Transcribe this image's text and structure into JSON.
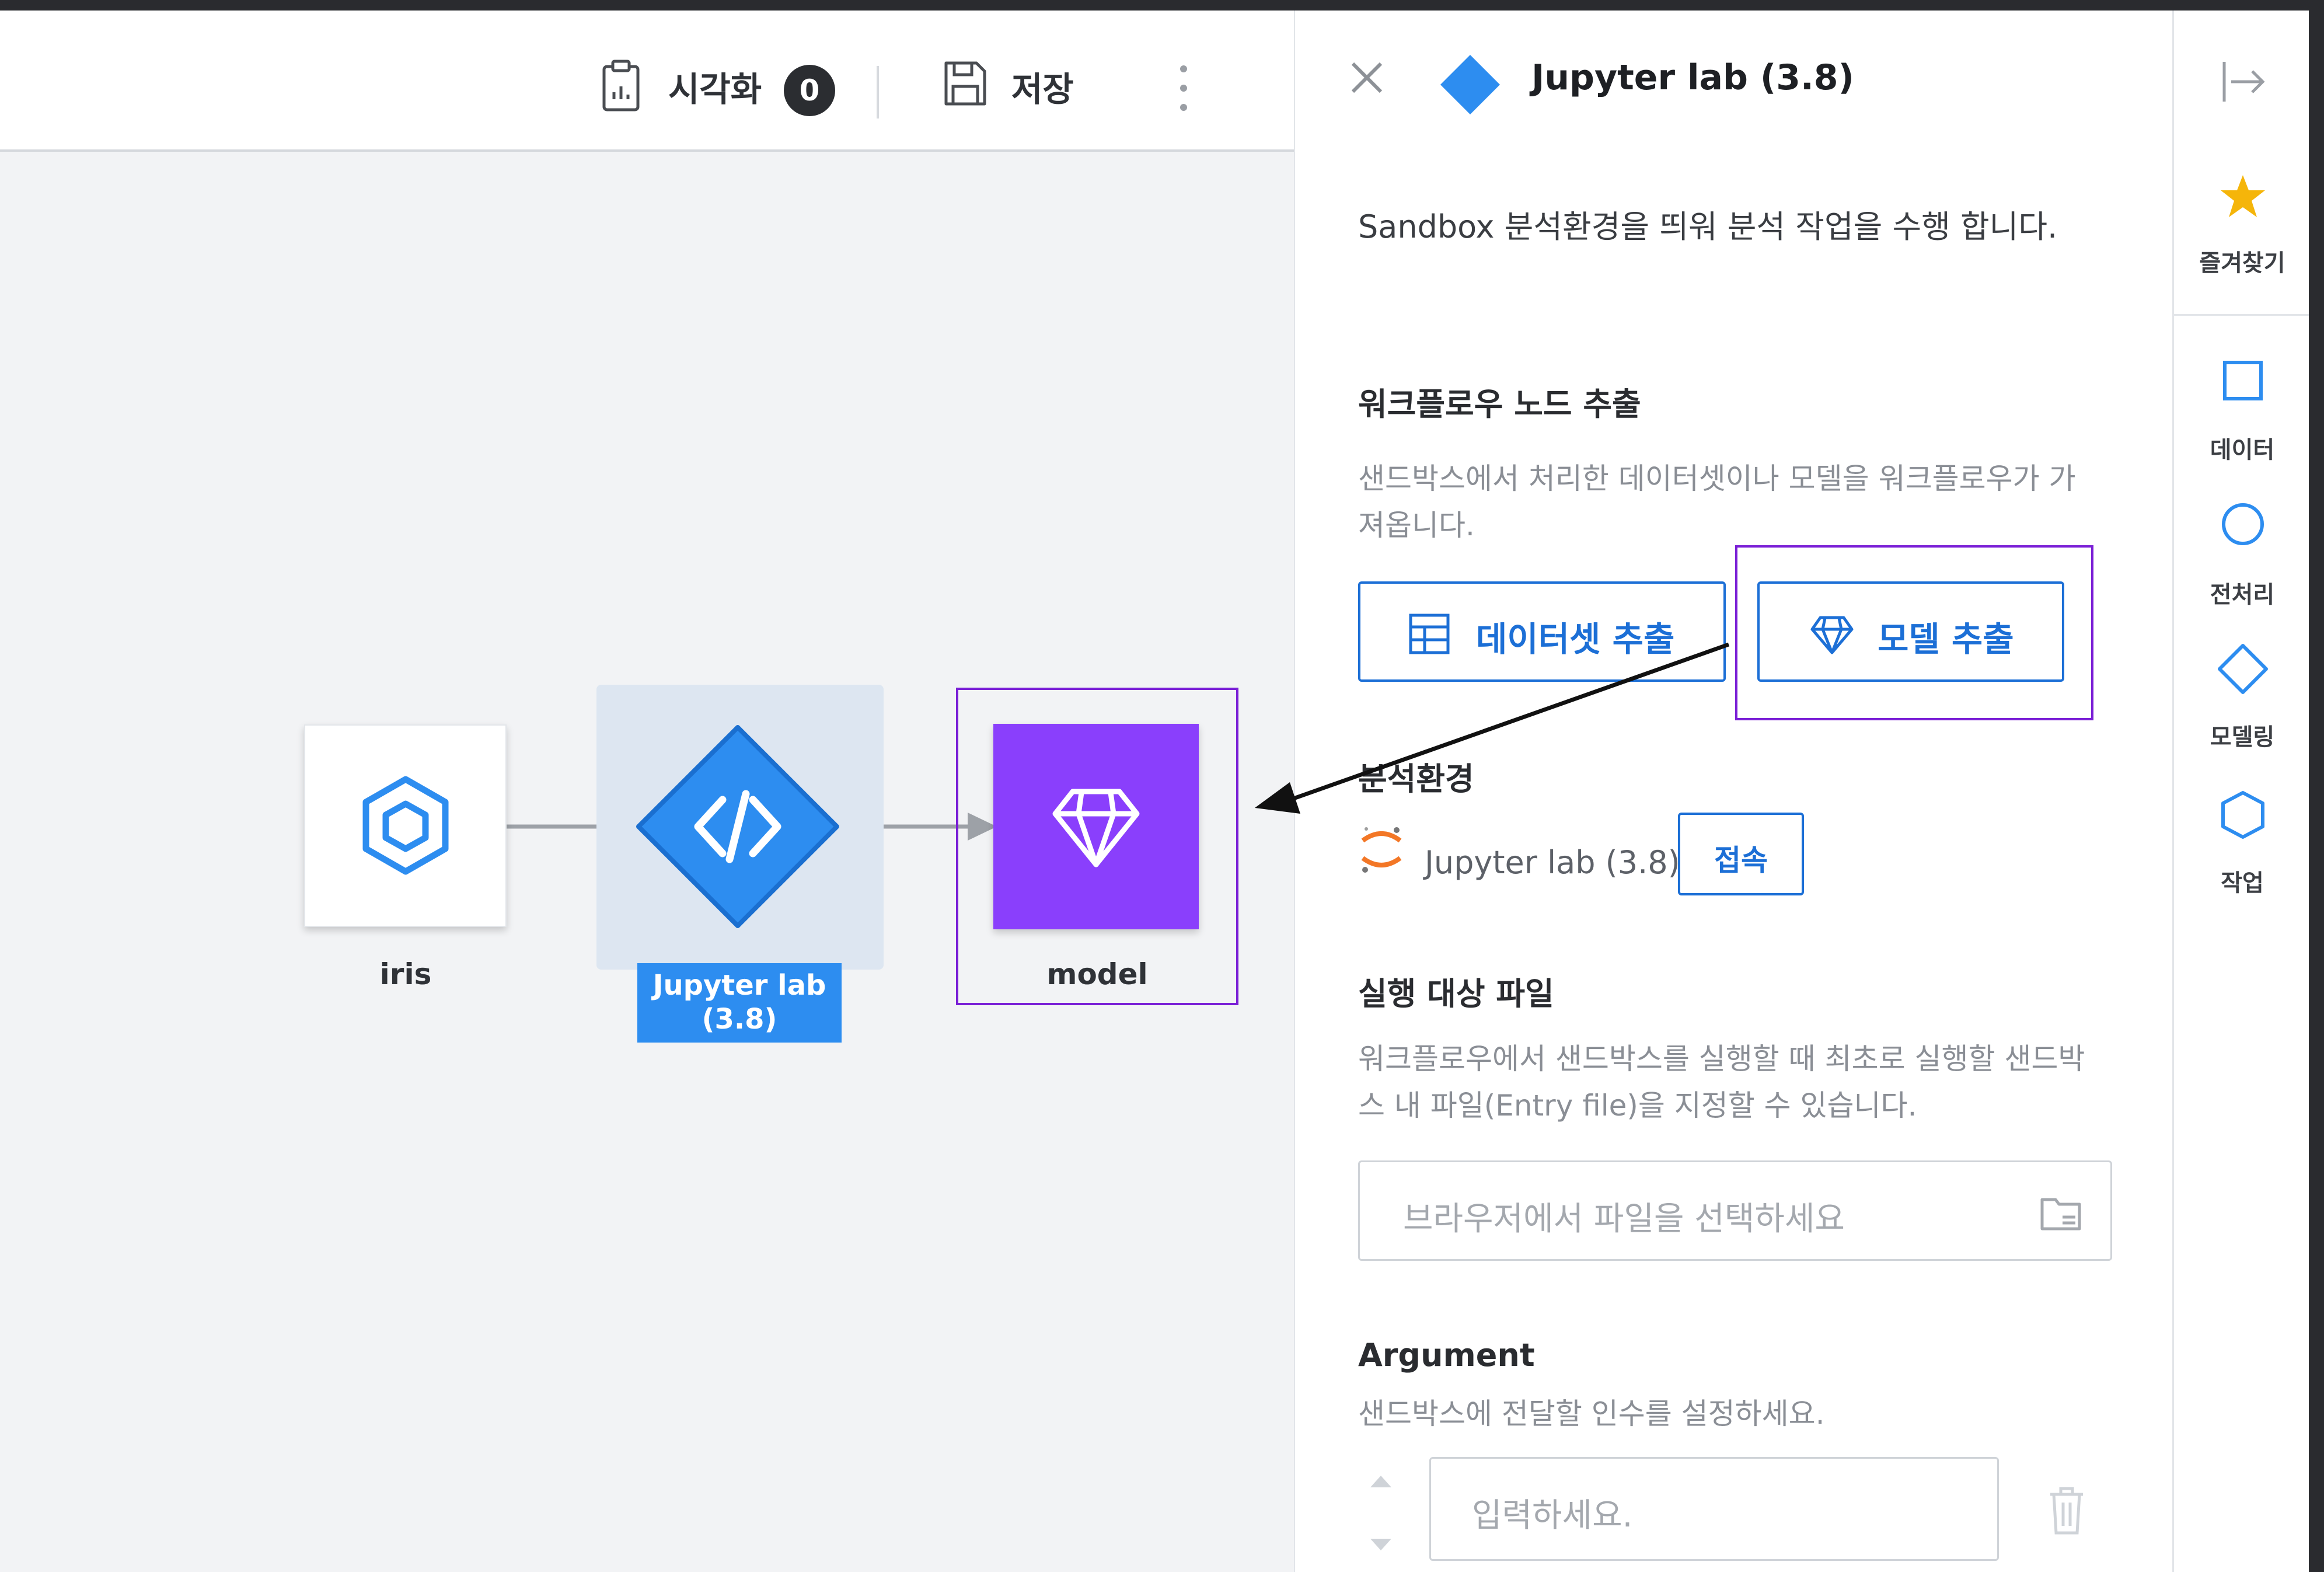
{
  "toolbar": {
    "visualize_label": "시각화",
    "visualize_count": "0",
    "save_label": "저장"
  },
  "canvas": {
    "nodes": [
      {
        "label": "iris",
        "icon": "hexagon-dataset-icon"
      },
      {
        "label": "Jupyter lab",
        "label2": "(3.8)",
        "icon": "code-icon"
      },
      {
        "label": "model",
        "icon": "diamond-gem-icon"
      }
    ]
  },
  "panel": {
    "title": "Jupyter lab (3.8)",
    "description": "Sandbox 분석환경을 띄워 분석 작업을 수행 합니다.",
    "extract": {
      "heading": "워크플로우 노드 추출",
      "desc_line1": "샌드박스에서 처리한 데이터셋이나 모델을 워크플로우가 가",
      "desc_line2": "져옵니다.",
      "dataset_button": "데이터셋 추출",
      "model_button": "모델 추출"
    },
    "env": {
      "heading": "분석환경",
      "name": "Jupyter lab (3.8)",
      "connect_button": "접속"
    },
    "entry_file": {
      "heading": "실행 대상 파일",
      "desc_line1": "워크플로우에서 샌드박스를 실행할 때 최초로 실행할 샌드박",
      "desc_line2": "스 내 파일(Entry file)을 지정할 수 있습니다.",
      "placeholder": "브라우저에서 파일을 선택하세요"
    },
    "argument": {
      "heading": "Argument",
      "desc": "샌드박스에 전달할 인수를 설정하세요.",
      "placeholder": "입력하세요."
    }
  },
  "rail": {
    "favorites": "즐겨찾기",
    "data": "데이터",
    "preprocess": "전처리",
    "modeling": "모델링",
    "job": "작업"
  },
  "colors": {
    "accent_blue": "#1c6fd6",
    "node_blue": "#2d8df0",
    "model_purple": "#8a3ffc",
    "annotation_purple": "#7a1fd6",
    "star_yellow": "#f5b50a"
  }
}
